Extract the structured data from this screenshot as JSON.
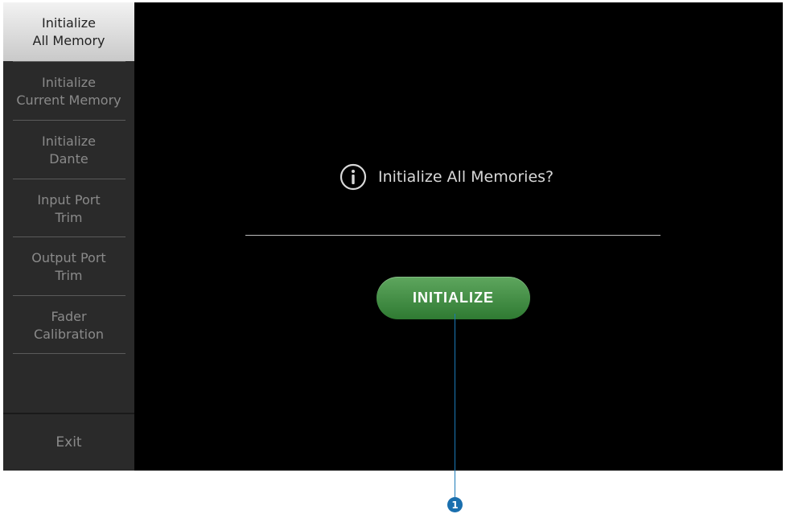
{
  "sidebar": {
    "items": [
      {
        "label": "Initialize\nAll Memory",
        "active": true
      },
      {
        "label": "Initialize\nCurrent Memory",
        "active": false
      },
      {
        "label": "Initialize\nDante",
        "active": false
      },
      {
        "label": "Input Port\nTrim",
        "active": false
      },
      {
        "label": "Output Port\nTrim",
        "active": false
      },
      {
        "label": "Fader\nCalibration",
        "active": false
      }
    ],
    "exit_label": "Exit"
  },
  "dialog": {
    "icon": "info-icon",
    "message": "Initialize All Memories?",
    "button_label": "INITIALIZE"
  },
  "callout": {
    "number": "1"
  },
  "colors": {
    "button_green": "#3f8f42",
    "callout_blue": "#1a6fae",
    "sidebar_bg": "#2a2a2a",
    "active_bg": "#e6e6e6"
  }
}
